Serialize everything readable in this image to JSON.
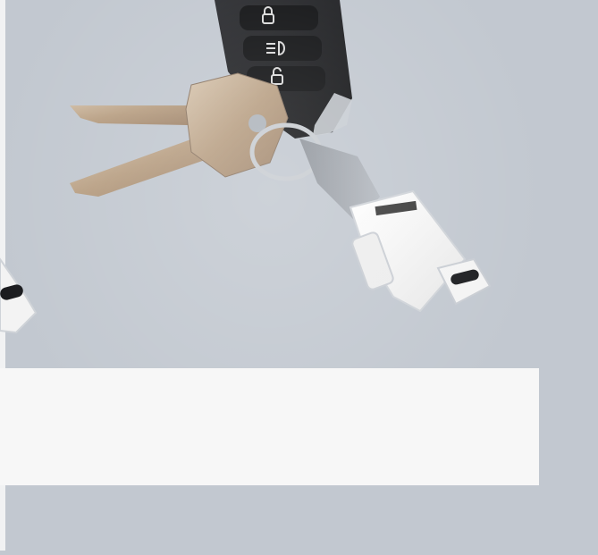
{
  "scene": {
    "description_hidden": "",
    "brand_text_on_device": "",
    "colors": {
      "background": "#c2c8d0",
      "panel": "#f7f7f7",
      "fob_body": "#1f2023",
      "metal": "#bfae98",
      "charger": "#f2f2f2"
    },
    "icons": [
      "lock-icon",
      "headlight-icon",
      "unlock-icon"
    ]
  },
  "caption": {
    "text": ""
  }
}
